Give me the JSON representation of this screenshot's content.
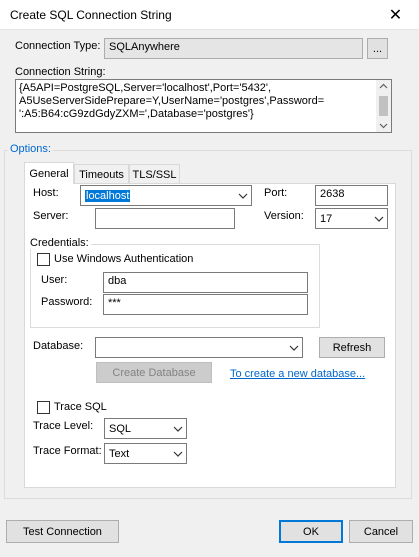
{
  "window": {
    "title": "Create SQL Connection String",
    "close_glyph": "✕"
  },
  "connection_type": {
    "label": "Connection Type:",
    "value": "SQLAnywhere",
    "browse_label": "..."
  },
  "connection_string": {
    "label": "Connection String:",
    "value": "{A5API=PostgreSQL,Server='localhost',Port='5432',\nA5UseServerSidePrepare=Y,UserName='postgres',Password=\n':A5:B64:cG9zdGdyZXM=',Database='postgres'}"
  },
  "options": {
    "label": "Options:",
    "tabs": [
      {
        "label": "General",
        "active": true
      },
      {
        "label": "Timeouts",
        "active": false
      },
      {
        "label": "TLS/SSL",
        "active": false
      }
    ]
  },
  "general": {
    "host_label": "Host:",
    "host_value": "localhost",
    "server_label": "Server:",
    "server_value": "",
    "port_label": "Port:",
    "port_value": "2638",
    "version_label": "Version:",
    "version_value": "17",
    "credentials": {
      "label": "Credentials:",
      "use_windows_auth_label": "Use Windows Authentication",
      "user_label": "User:",
      "user_value": "dba",
      "password_label": "Password:",
      "password_value": "***"
    },
    "database_label": "Database:",
    "database_value": "",
    "refresh_label": "Refresh",
    "create_database_label": "Create Database",
    "create_link_label": "To create a new database...",
    "trace_sql_label": "Trace SQL",
    "trace_level_label": "Trace Level:",
    "trace_level_value": "SQL",
    "trace_format_label": "Trace Format:",
    "trace_format_value": "Text"
  },
  "footer": {
    "test_label": "Test Connection",
    "ok_label": "OK",
    "cancel_label": "Cancel"
  },
  "colors": {
    "accent": "#0078d7",
    "link": "#0066cc",
    "options_label": "#0066cc"
  }
}
